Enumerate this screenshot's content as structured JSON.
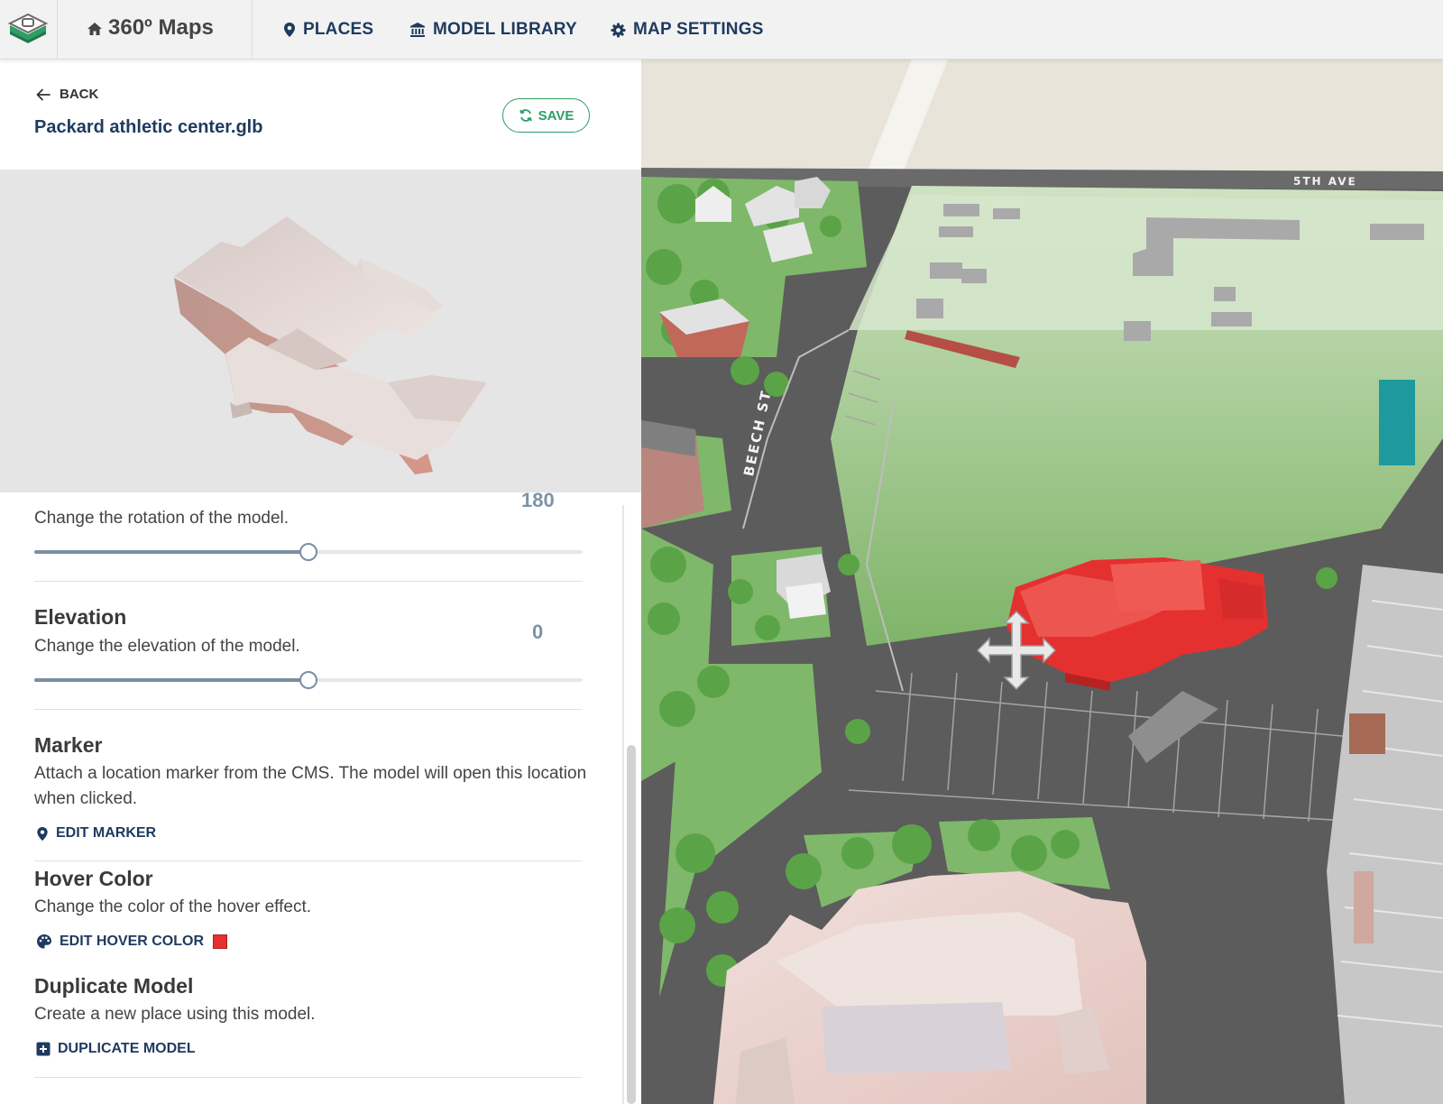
{
  "app": {
    "title": "360º Maps"
  },
  "nav": {
    "places": "PLACES",
    "model_library": "MODEL LIBRARY",
    "map_settings": "MAP SETTINGS"
  },
  "editor": {
    "back_label": "BACK",
    "file_name": "Packard athletic center.glb",
    "save_label": "SAVE",
    "rotation": {
      "desc": "Change the rotation of the model.",
      "value": "180",
      "fraction": 0.5
    },
    "elevation": {
      "title": "Elevation",
      "desc": "Change the elevation of the model.",
      "value": "0",
      "fraction": 0.5
    },
    "marker": {
      "title": "Marker",
      "desc": "Attach a location marker from the CMS. The model will open this location when clicked.",
      "action": "EDIT MARKER"
    },
    "hover_color": {
      "title": "Hover Color",
      "desc": "Change the color of the hover effect.",
      "action": "EDIT HOVER COLOR",
      "color": "#e53030"
    },
    "duplicate": {
      "title": "Duplicate Model",
      "desc": "Create a new place using this model.",
      "action": "DUPLICATE MODEL"
    }
  },
  "map": {
    "street_labels": [
      "5TH AVE",
      "BEECH ST"
    ]
  },
  "colors": {
    "accent_navy": "#1e3a5f",
    "save_green": "#2e9e66",
    "highlight_red": "#e53030"
  }
}
